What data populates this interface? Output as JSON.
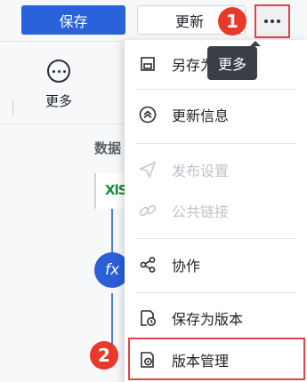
{
  "toolbar": {
    "save_label": "保存",
    "update_label": "更新",
    "more_tooltip": "更多",
    "badge_1": "1",
    "badge_2": "2"
  },
  "left_tools": {
    "more_label": "更多"
  },
  "canvas": {
    "section_label": "数据",
    "source_icon": "xls-file-icon",
    "source_text": "XlS",
    "formula_node_text": "fx"
  },
  "menu": {
    "items": [
      {
        "label": "另存为",
        "icon": "save-as-icon",
        "enabled": true
      },
      {
        "label": "更新信息",
        "icon": "update-info-icon",
        "enabled": true
      },
      {
        "label": "发布设置",
        "icon": "send-icon",
        "enabled": false
      },
      {
        "label": "公共链接",
        "icon": "link-icon",
        "enabled": false
      },
      {
        "label": "协作",
        "icon": "share-icon",
        "enabled": true
      },
      {
        "label": "保存为版本",
        "icon": "save-version-icon",
        "enabled": true
      },
      {
        "label": "版本管理",
        "icon": "version-manage-icon",
        "enabled": true
      }
    ]
  },
  "colors": {
    "accent": "#2962d9",
    "highlight_red": "#e04444",
    "badge_red": "#e8392c"
  }
}
